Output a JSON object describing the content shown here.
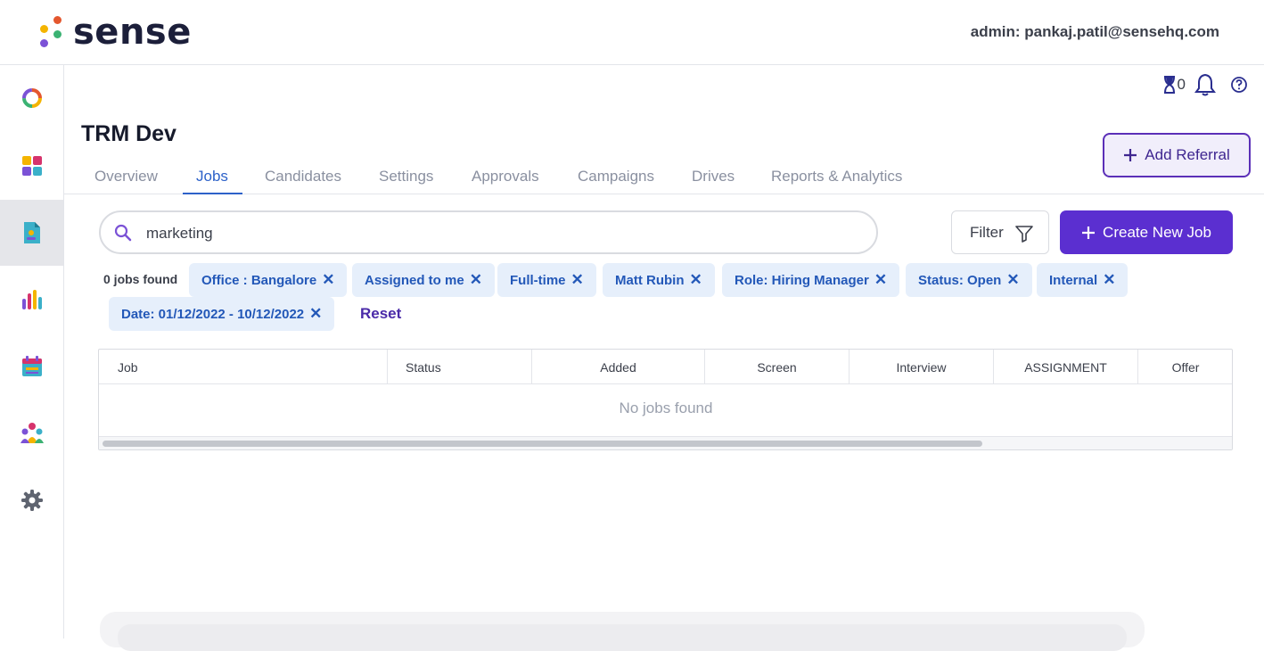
{
  "header": {
    "logo_text": "sense",
    "admin_label": "admin: pankaj.patil@sensehq.com"
  },
  "sidebar": {
    "items": [
      {
        "icon": "ring-chart-icon"
      },
      {
        "icon": "apps-grid-icon"
      },
      {
        "icon": "jobs-document-icon",
        "active": true
      },
      {
        "icon": "bar-chart-icon"
      },
      {
        "icon": "calendar-icon"
      },
      {
        "icon": "people-icon"
      },
      {
        "icon": "settings-gear-icon"
      }
    ]
  },
  "utilities": {
    "hourglass_count": "0"
  },
  "page": {
    "title": "TRM Dev",
    "add_referral_label": "Add Referral"
  },
  "tabs": [
    {
      "label": "Overview"
    },
    {
      "label": "Jobs",
      "active": true
    },
    {
      "label": "Candidates"
    },
    {
      "label": "Settings"
    },
    {
      "label": "Approvals"
    },
    {
      "label": "Campaigns"
    },
    {
      "label": "Drives"
    },
    {
      "label": "Reports & Analytics"
    }
  ],
  "search": {
    "value": "marketing"
  },
  "filter_label": "Filter",
  "create_job_label": "Create New Job",
  "results": {
    "count_text": "0 jobs found",
    "chips": [
      "Office : Bangalore",
      "Assigned to me",
      "Full-time",
      "Matt Rubin",
      "Role: Hiring Manager",
      "Status: Open",
      "Internal",
      "Date: 01/12/2022 - 10/12/2022"
    ],
    "reset_label": "Reset"
  },
  "table": {
    "columns": [
      "Job",
      "Status",
      "Added",
      "Screen",
      "Interview",
      "ASSIGNMENT",
      "Offer"
    ],
    "empty_text": "No jobs found"
  },
  "colors": {
    "accent": "#5b2fd0",
    "tab_active": "#2d62c9",
    "chip_bg": "#e6effb",
    "chip_text": "#2358b8"
  }
}
